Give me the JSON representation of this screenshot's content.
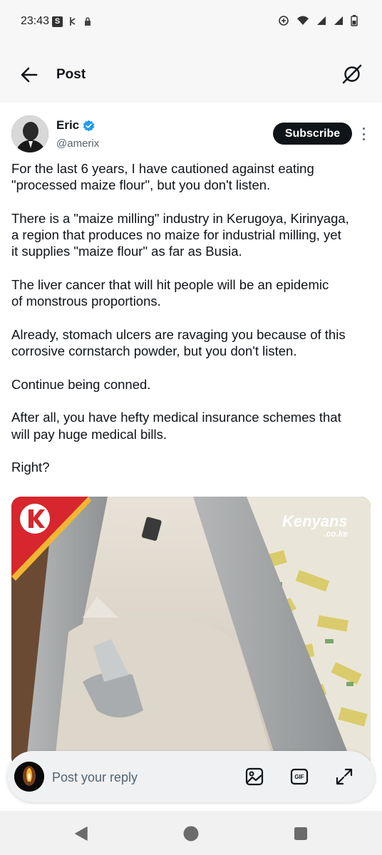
{
  "status_bar": {
    "time": "23:43",
    "s_badge": "S",
    "left_icons": [
      "s-app-icon",
      "usb-icon",
      "lock-icon"
    ],
    "right_icons": [
      "data-saver-icon",
      "wifi-icon",
      "signal-icon",
      "signal-icon",
      "battery-icon"
    ]
  },
  "header": {
    "title": "Post",
    "back_icon": "arrow-left-icon",
    "grok_icon": "grok-icon"
  },
  "author": {
    "name": "Eric",
    "handle": "@amerix",
    "verified": true,
    "subscribe_label": "Subscribe"
  },
  "tweet": {
    "paragraphs": [
      "For the last 6 years, I have cautioned against eating\n\"processed maize flour\", but you don't listen.",
      "There is a \"maize milling\" industry in Kerugoya, Kirinyaga,\na region that produces no maize for industrial milling, yet\nit supplies \"maize flour\" as far as Busia.",
      "The liver cancer that will hit people will be an epidemic\nof monstrous proportions.",
      "Already, stomach ulcers are ravaging you because of this\ncorrosive cornstarch powder, but you don't listen.",
      "Continue being conned.",
      "After all, you have hefty medical insurance schemes that\nwill pay huge medical bills.",
      "Right?"
    ]
  },
  "media": {
    "watermark_main": "Kenyans",
    "watermark_sub": ".co.ke",
    "badge_letter": "K"
  },
  "reply": {
    "placeholder": "Post your reply",
    "gif_label": "GIF",
    "icons": [
      "image-icon",
      "gif-icon",
      "expand-icon"
    ]
  },
  "colors": {
    "accent": "#1d9bf0",
    "text": "#0f1419",
    "secondary": "#536471",
    "badge_red": "#d7262e"
  }
}
